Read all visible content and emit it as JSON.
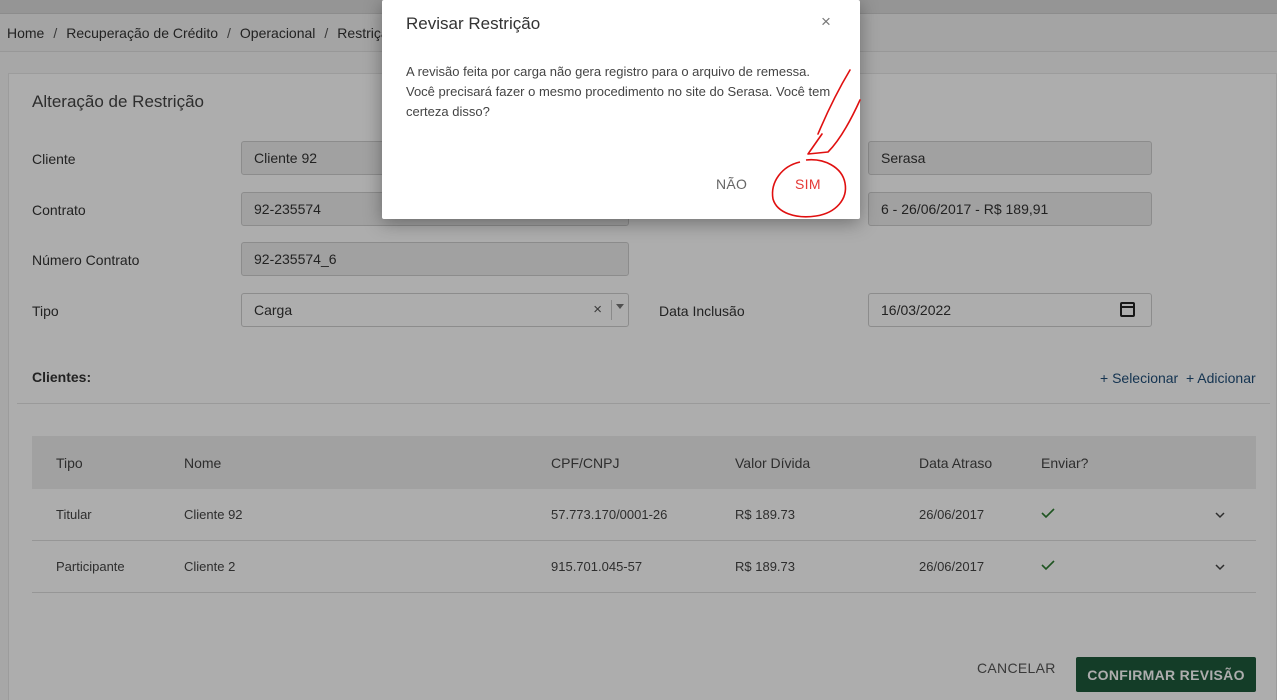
{
  "breadcrumb": [
    "Home",
    "Recuperação de Crédito",
    "Operacional",
    "Restrição"
  ],
  "card": {
    "title": "Alteração de Restrição"
  },
  "form": {
    "cliente_label": "Cliente",
    "cliente_value": "Cliente 92",
    "contrato_label": "Contrato",
    "contrato_value": "92-235574",
    "numero_contrato_label": "Número Contrato",
    "numero_contrato_value": "92-235574_6",
    "tipo_label": "Tipo",
    "tipo_value": "Carga",
    "tipo_clear": "×",
    "orgao_value": "Serasa",
    "parcela_value": "6 - 26/06/2017 - R$ 189,91",
    "data_inclusao_label": "Data Inclusão",
    "data_inclusao_value": "16/03/2022"
  },
  "clients": {
    "title": "Clientes:",
    "select_link": "+ Selecionar",
    "add_link": "+ Adicionar"
  },
  "table": {
    "headers": [
      "Tipo",
      "Nome",
      "CPF/CNPJ",
      "Valor Dívida",
      "Data Atraso",
      "Enviar?"
    ],
    "rows": [
      {
        "tipo": "Titular",
        "nome": "Cliente 92",
        "cpf": "57.773.170/0001-26",
        "valor": "R$ 189.73",
        "data": "26/06/2017",
        "enviar": true
      },
      {
        "tipo": "Participante",
        "nome": "Cliente 2",
        "cpf": "915.701.045-57",
        "valor": "R$ 189.73",
        "data": "26/06/2017",
        "enviar": true
      }
    ]
  },
  "actions": {
    "cancel": "CANCELAR",
    "confirm": "CONFIRMAR REVISÃO"
  },
  "modal": {
    "title": "Revisar Restrição",
    "close": "×",
    "body": "A revisão feita por carga não gera registro para o arquivo de remessa. Você precisará fazer o mesmo procedimento no site do Serasa. Você tem certeza disso?",
    "no": "NÃO",
    "yes": "SIM"
  },
  "colors": {
    "primary": "#1e5a3c",
    "danger": "#e53935",
    "check": "#2e7d32",
    "annotation": "#e01010"
  }
}
